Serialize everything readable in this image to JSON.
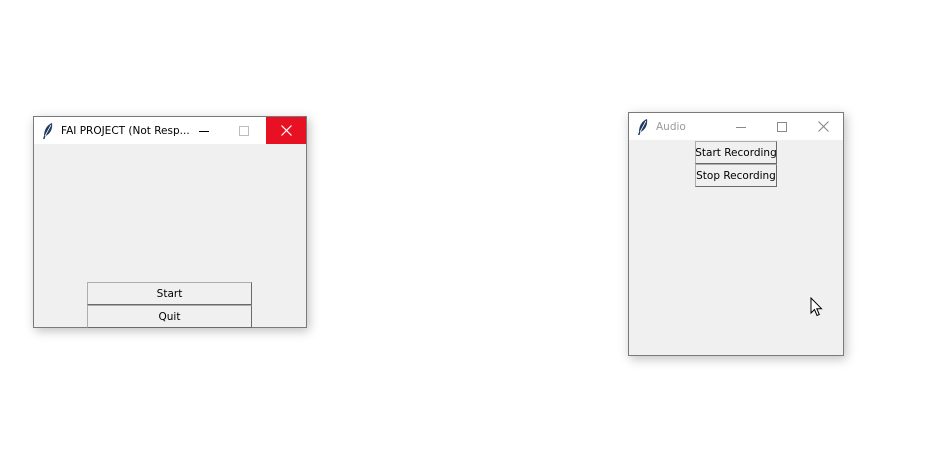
{
  "windows": {
    "main": {
      "title": "FAI PROJECT (Not Resp...",
      "buttons": {
        "start_label": "Start",
        "quit_label": "Quit"
      },
      "icons": {
        "app": "feather-icon",
        "minimize": "minimize-icon",
        "maximize": "maximize-icon",
        "close": "close-icon"
      }
    },
    "audio": {
      "title": "Audio",
      "buttons": {
        "start_recording_label": "Start Recording",
        "stop_recording_label": "Stop Recording"
      },
      "icons": {
        "app": "feather-icon",
        "minimize": "minimize-icon",
        "maximize": "maximize-icon",
        "close": "close-icon"
      }
    }
  },
  "colors": {
    "close_hover": "#e81123",
    "window_bg": "#f0f0f0",
    "titlebar_bg": "#ffffff",
    "inactive_title": "#9a9a9a"
  }
}
